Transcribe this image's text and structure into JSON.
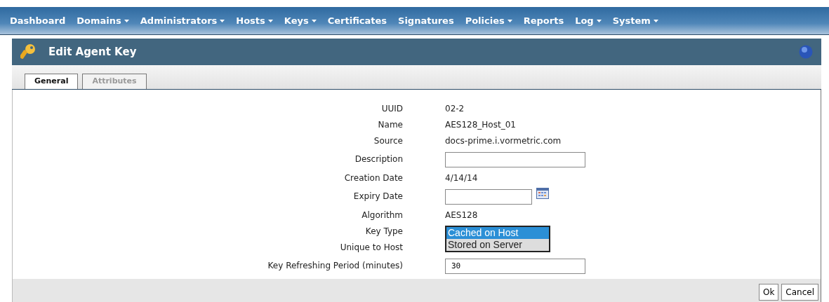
{
  "menu": [
    {
      "label": "Dashboard",
      "dropdown": false
    },
    {
      "label": "Domains",
      "dropdown": true
    },
    {
      "label": "Administrators",
      "dropdown": true
    },
    {
      "label": "Hosts",
      "dropdown": true
    },
    {
      "label": "Keys",
      "dropdown": true
    },
    {
      "label": "Certificates",
      "dropdown": false
    },
    {
      "label": "Signatures",
      "dropdown": false
    },
    {
      "label": "Policies",
      "dropdown": true
    },
    {
      "label": "Reports",
      "dropdown": false
    },
    {
      "label": "Log",
      "dropdown": true
    },
    {
      "label": "System",
      "dropdown": true
    }
  ],
  "header": {
    "title": "Edit Agent Key"
  },
  "tabs": [
    {
      "label": "General",
      "selected": true
    },
    {
      "label": "Attributes",
      "selected": false
    }
  ],
  "fields": [
    {
      "label": "UUID",
      "kind": "text",
      "value": "02-2"
    },
    {
      "label": "Name",
      "kind": "text",
      "value": "AES128_Host_01"
    },
    {
      "label": "Source",
      "kind": "text",
      "value": "docs-prime.i.vormetric.com"
    },
    {
      "label": "Description",
      "kind": "input"
    },
    {
      "label": "Creation Date",
      "kind": "text",
      "value": "4/14/14"
    },
    {
      "label": "Expiry Date",
      "kind": "date"
    },
    {
      "label": "Algorithm",
      "kind": "text",
      "value": "AES128"
    },
    {
      "label": "Key Type",
      "kind": "listbox",
      "options": [
        {
          "label": "Cached on Host",
          "selected": true
        },
        {
          "label": "Stored on Server",
          "selected": false
        }
      ]
    },
    {
      "label": "Unique to Host",
      "kind": "hidden"
    },
    {
      "label": "Key Refreshing Period (minutes)",
      "kind": "input",
      "value": "30"
    }
  ],
  "buttons": [
    "Ok",
    "Cancel"
  ]
}
